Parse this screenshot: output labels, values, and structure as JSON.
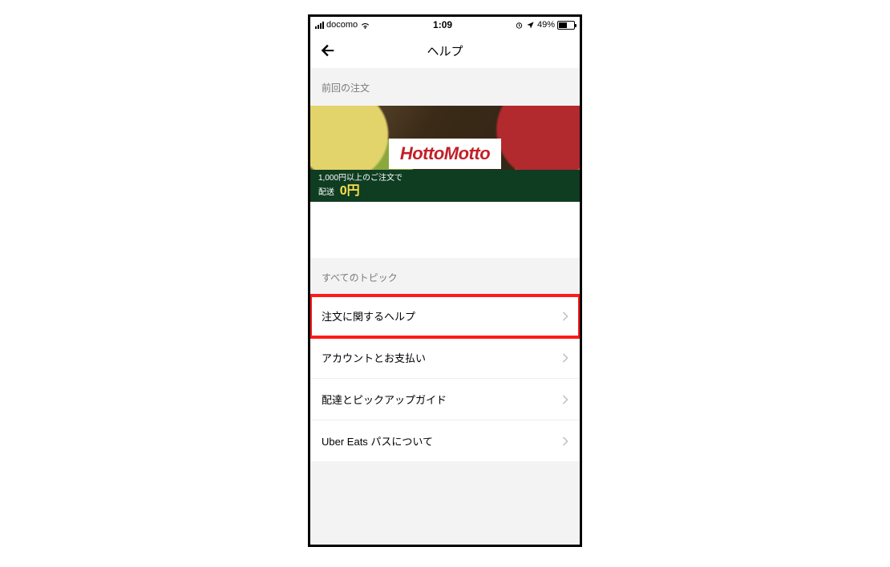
{
  "status_bar": {
    "carrier": "docomo",
    "time": "1:09",
    "battery_pct": "49%"
  },
  "nav": {
    "title": "ヘルプ"
  },
  "sections": {
    "last_order": "前回の注文",
    "all_topics": "すべてのトピック"
  },
  "promo": {
    "brand": "HottoMotto",
    "sub_line1": "1,000円以上のご注文で",
    "sub_line2_prefix": "配送",
    "sub_line2_highlight": "0円"
  },
  "topics": {
    "0": {
      "label": "注文に関するヘルプ"
    },
    "1": {
      "label": "アカウントとお支払い"
    },
    "2": {
      "label": "配達とピックアップガイド"
    },
    "3": {
      "label": "Uber Eats パスについて"
    }
  }
}
